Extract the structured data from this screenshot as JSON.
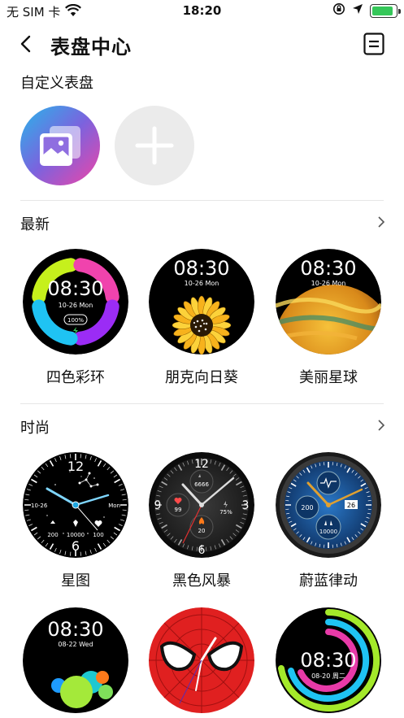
{
  "status_bar": {
    "carrier": "无 SIM 卡",
    "time": "18:20",
    "battery_level": 0.9
  },
  "nav": {
    "title": "表盘中心"
  },
  "custom": {
    "title": "自定义表盘"
  },
  "latest": {
    "title": "最新",
    "items": [
      {
        "label": "四色彩环",
        "time": "08:30",
        "date": "10-26 Mon",
        "percent": "100%"
      },
      {
        "label": "朋克向日葵",
        "time": "08:30",
        "date": "10-26 Mon"
      },
      {
        "label": "美丽星球",
        "time": "08:30",
        "date": "10-26 Mon"
      }
    ]
  },
  "fashion": {
    "title": "时尚",
    "items": [
      {
        "label": "星图",
        "hour12": "12",
        "hour6": "6",
        "date_left": "10-26",
        "day_right": "Mon",
        "stats": [
          "200",
          "10000",
          "100"
        ]
      },
      {
        "label": "黑色风暴",
        "hour12": "12",
        "hour3": "3",
        "hour6": "6",
        "hour9": "9",
        "steps": "6666",
        "battery": "75%",
        "heart": "99",
        "calorie": "20"
      },
      {
        "label": "蔚蓝律动",
        "left_value": "200",
        "date_num": "26",
        "steps": "10000"
      }
    ]
  },
  "bottom_row": [
    {
      "time": "08:30",
      "date": "08-22 Wed"
    },
    {},
    {
      "time": "08:30",
      "date": "08-20 周二"
    }
  ],
  "colors": {
    "accent_green": "#35c759",
    "divider": "#e6e6e6"
  }
}
